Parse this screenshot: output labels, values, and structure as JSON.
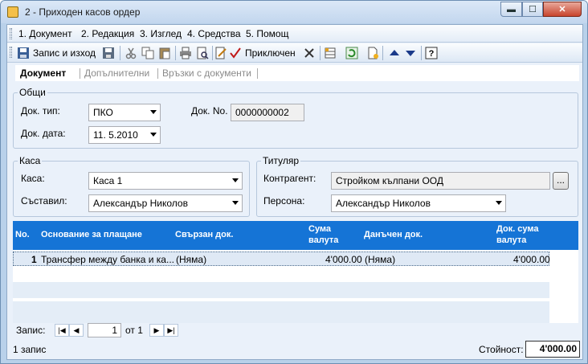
{
  "window": {
    "title": "2 - Приходен касов ордер",
    "min": "▬",
    "max": "☐",
    "close": "✕"
  },
  "menu": [
    {
      "label": "1. Документ"
    },
    {
      "label": "2. Редакция"
    },
    {
      "label": "3. Изглед"
    },
    {
      "label": "4. Средства"
    },
    {
      "label": "5. Помощ"
    }
  ],
  "toolbar": {
    "save_exit": "Запис и изход",
    "completed": "Приключен"
  },
  "tabs": {
    "document": "Документ",
    "additional": "Допълнителни",
    "links": "Връзки с документи"
  },
  "general": {
    "title": "Общи",
    "doc_type_label": "Док. тип:",
    "doc_type_value": "ПКО",
    "doc_no_label": "Док. No.",
    "doc_no_value": "0000000002",
    "doc_date_label": "Док. дата:",
    "doc_date_value": "11.  5.2010"
  },
  "cash": {
    "title": "Каса",
    "cash_label": "Каса:",
    "cash_value": "Каса 1",
    "author_label": "Съставил:",
    "author_value": "Александър Николов"
  },
  "holder": {
    "title": "Титуляр",
    "contractor_label": "Контрагент:",
    "contractor_value": "Стройком кълпани ООД",
    "person_label": "Персона:",
    "person_value": "Александър Николов",
    "browse": "..."
  },
  "grid": {
    "headers": {
      "no": "No.",
      "basis": "Основание за плащане",
      "linked": "Свързан док.",
      "amount1": "Сума",
      "amount2": "валута",
      "tax": "Данъчен док.",
      "docsum1": "Док. сума",
      "docsum2": "валута"
    },
    "rows": [
      {
        "no": "1",
        "basis": "Трансфер между банка и ка...",
        "linked": "(Няма)",
        "amount": "4'000.00",
        "tax": "(Няма)",
        "docsum": "4'000.00"
      }
    ]
  },
  "pager": {
    "label": "Запис:",
    "current": "1",
    "of": "от 1"
  },
  "status": {
    "count": "1 запис",
    "value_label": "Стойност:",
    "value": "4'000.00"
  },
  "colors": {
    "grid_header": "#1574d6",
    "panel": "#eaf1fa"
  }
}
